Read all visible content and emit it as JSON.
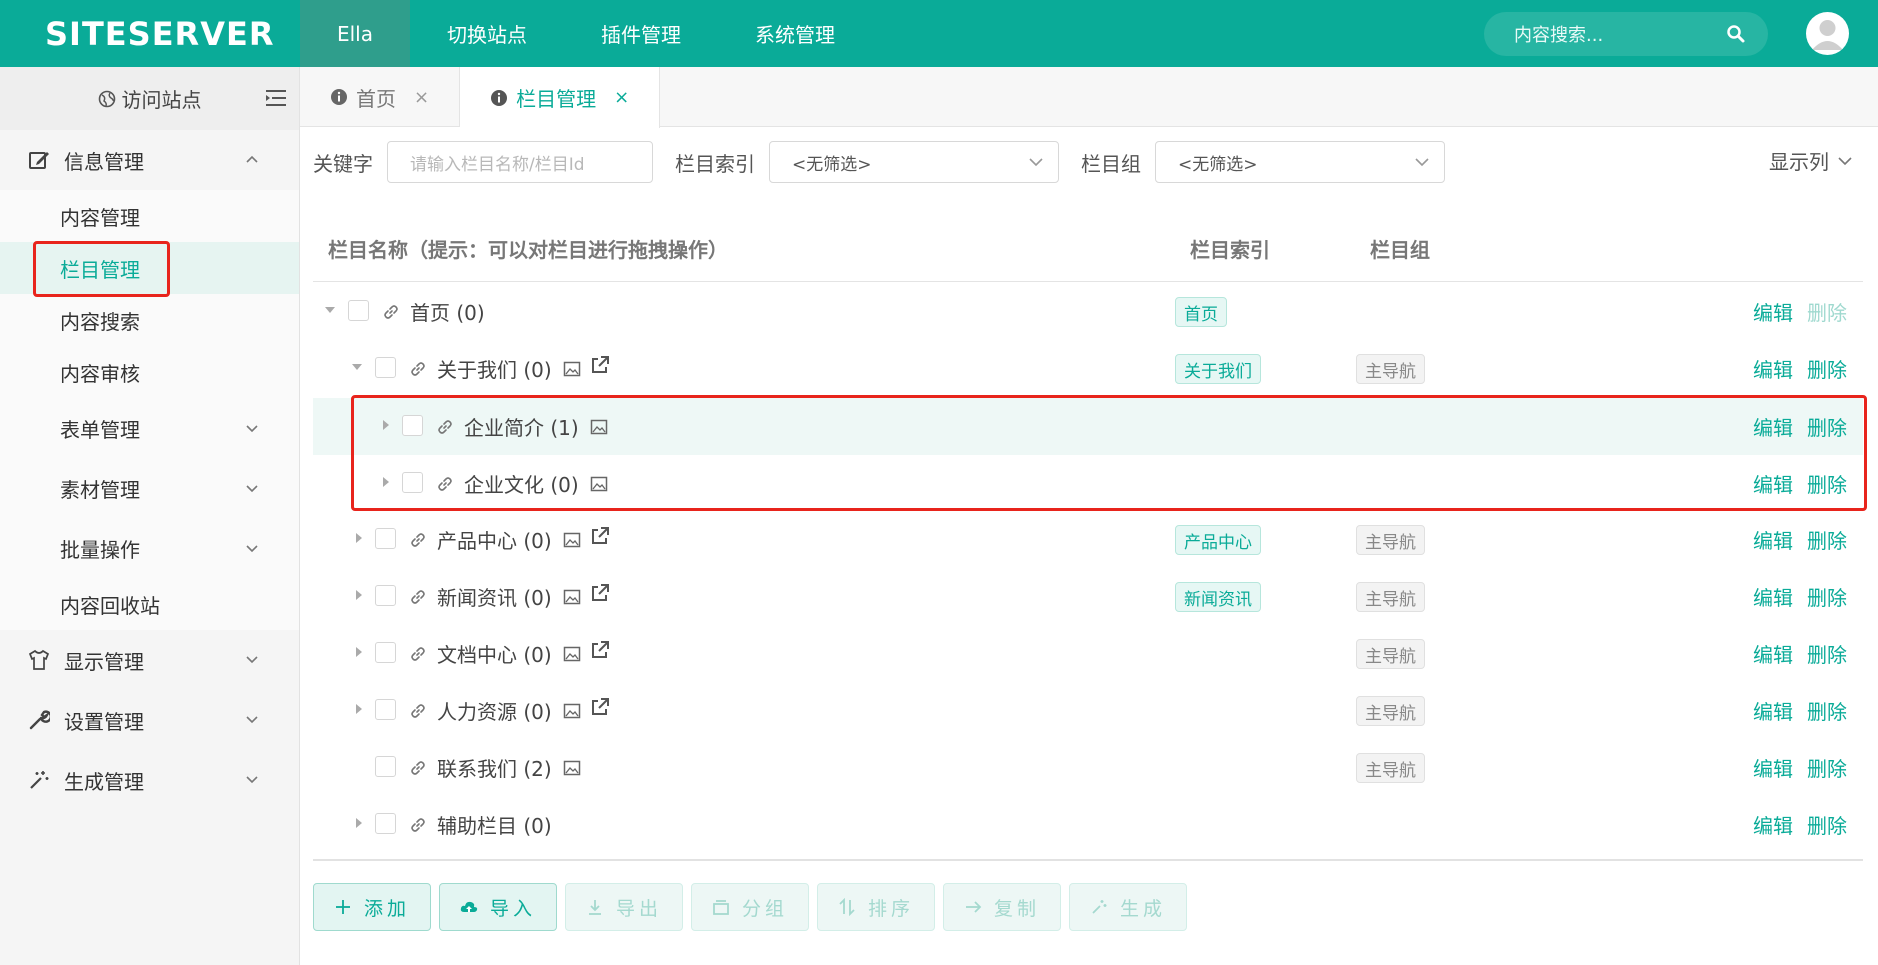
{
  "app": {
    "logo": "SITESERVER"
  },
  "topnav": {
    "items": [
      {
        "label": "Ella"
      },
      {
        "label": "切换站点"
      },
      {
        "label": "插件管理"
      },
      {
        "label": "系统管理"
      }
    ],
    "search_placeholder": "内容搜索..."
  },
  "sidebar": {
    "visit_label": "访问站点",
    "groups": {
      "info": {
        "label": "信息管理"
      },
      "display": {
        "label": "显示管理"
      },
      "settings": {
        "label": "设置管理"
      },
      "generate": {
        "label": "生成管理"
      }
    },
    "subs": [
      {
        "label": "内容管理"
      },
      {
        "label": "栏目管理"
      },
      {
        "label": "内容搜索"
      },
      {
        "label": "内容审核"
      },
      {
        "label": "表单管理"
      },
      {
        "label": "素材管理"
      },
      {
        "label": "批量操作"
      },
      {
        "label": "内容回收站"
      }
    ]
  },
  "tabs": [
    {
      "label": "首页",
      "close": "×"
    },
    {
      "label": "栏目管理",
      "close": "×"
    }
  ],
  "filters": {
    "keyword_label": "关键字",
    "keyword_placeholder": "请输入栏目名称/栏目Id",
    "index_label": "栏目索引",
    "index_value": "<无筛选>",
    "group_label": "栏目组",
    "group_value": "<无筛选>",
    "show_columns": "显示列"
  },
  "table": {
    "headers": {
      "name": "栏目名称（提示：可以对栏目进行拖拽操作）",
      "index": "栏目索引",
      "group": "栏目组"
    },
    "edit_label": "编辑",
    "delete_label": "删除",
    "rows": [
      {
        "name": "首页 (0)",
        "index": "首页",
        "group": ""
      },
      {
        "name": "关于我们 (0)",
        "index": "关于我们",
        "group": "主导航"
      },
      {
        "name": "企业简介 (1)",
        "index": "",
        "group": ""
      },
      {
        "name": "企业文化 (0)",
        "index": "",
        "group": ""
      },
      {
        "name": "产品中心 (0)",
        "index": "产品中心",
        "group": "主导航"
      },
      {
        "name": "新闻资讯 (0)",
        "index": "新闻资讯",
        "group": "主导航"
      },
      {
        "name": "文档中心 (0)",
        "index": "",
        "group": "主导航"
      },
      {
        "name": "人力资源 (0)",
        "index": "",
        "group": "主导航"
      },
      {
        "name": "联系我们 (2)",
        "index": "",
        "group": "主导航"
      },
      {
        "name": "辅助栏目 (0)",
        "index": "",
        "group": ""
      }
    ]
  },
  "buttons": {
    "add": "添加",
    "import": "导入",
    "export": "导出",
    "group": "分组",
    "sort": "排序",
    "copy": "复制",
    "generate": "生成"
  },
  "colors": {
    "brand": "#0aab98",
    "highlight": "#e8241c"
  }
}
